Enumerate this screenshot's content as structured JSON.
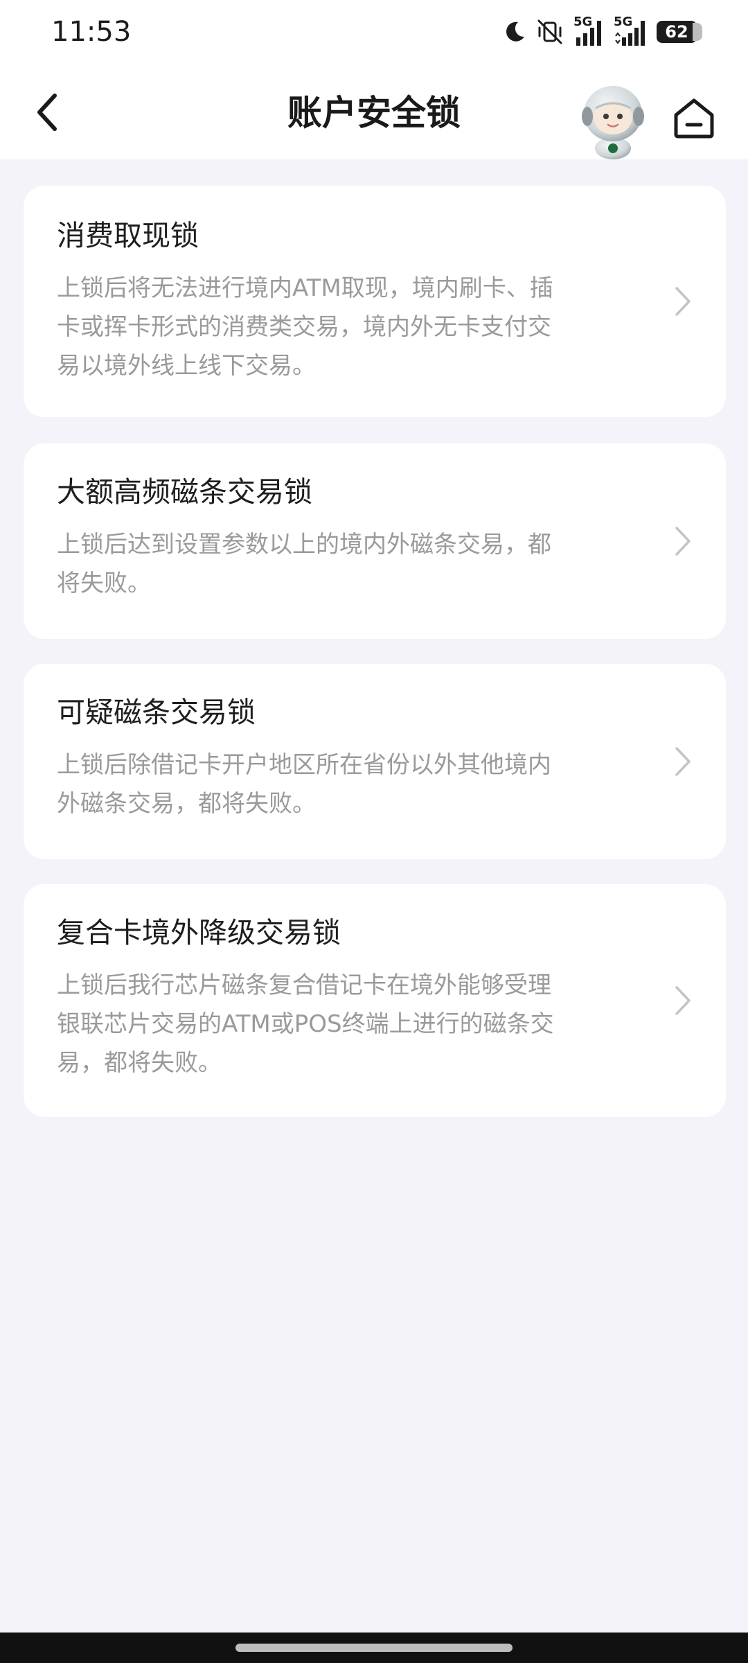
{
  "status_bar": {
    "time": "11:53",
    "icons": [
      "moon-icon",
      "vibrate-off-icon",
      "signal-icon",
      "signal-icon"
    ],
    "network_1": "5G",
    "network_2": "5G",
    "battery": "62"
  },
  "header": {
    "title": "账户安全锁",
    "back_icon": "chevron-left-icon",
    "assistant_icon": "robot-assistant-icon",
    "home_icon": "home-icon"
  },
  "locks": [
    {
      "title": "消费取现锁",
      "desc_lines": [
        "上锁后将无法进行境内ATM取现，境内刷卡、插",
        "卡或挥卡形式的消费类交易，境内外无卡支付交",
        "易以境外线上线下交易。"
      ]
    },
    {
      "title": "大额高频磁条交易锁",
      "desc_lines": [
        "上锁后达到设置参数以上的境内外磁条交易，都",
        "将失败。"
      ]
    },
    {
      "title": "可疑磁条交易锁",
      "desc_lines": [
        "上锁后除借记卡开户地区所在省份以外其他境内",
        "外磁条交易，都将失败。"
      ]
    },
    {
      "title": "复合卡境外降级交易锁",
      "desc_lines": [
        "上锁后我行芯片磁条复合借记卡在境外能够受理",
        "银联芯片交易的ATM或POS终端上进行的磁条交",
        "易，都将失败。"
      ]
    }
  ],
  "colors": {
    "page_background": "#f3f3f9",
    "card_background": "#ffffff",
    "title_text": "#1e1e1e",
    "desc_text": "#9a9a9a",
    "chevron": "#c4c4c4"
  }
}
